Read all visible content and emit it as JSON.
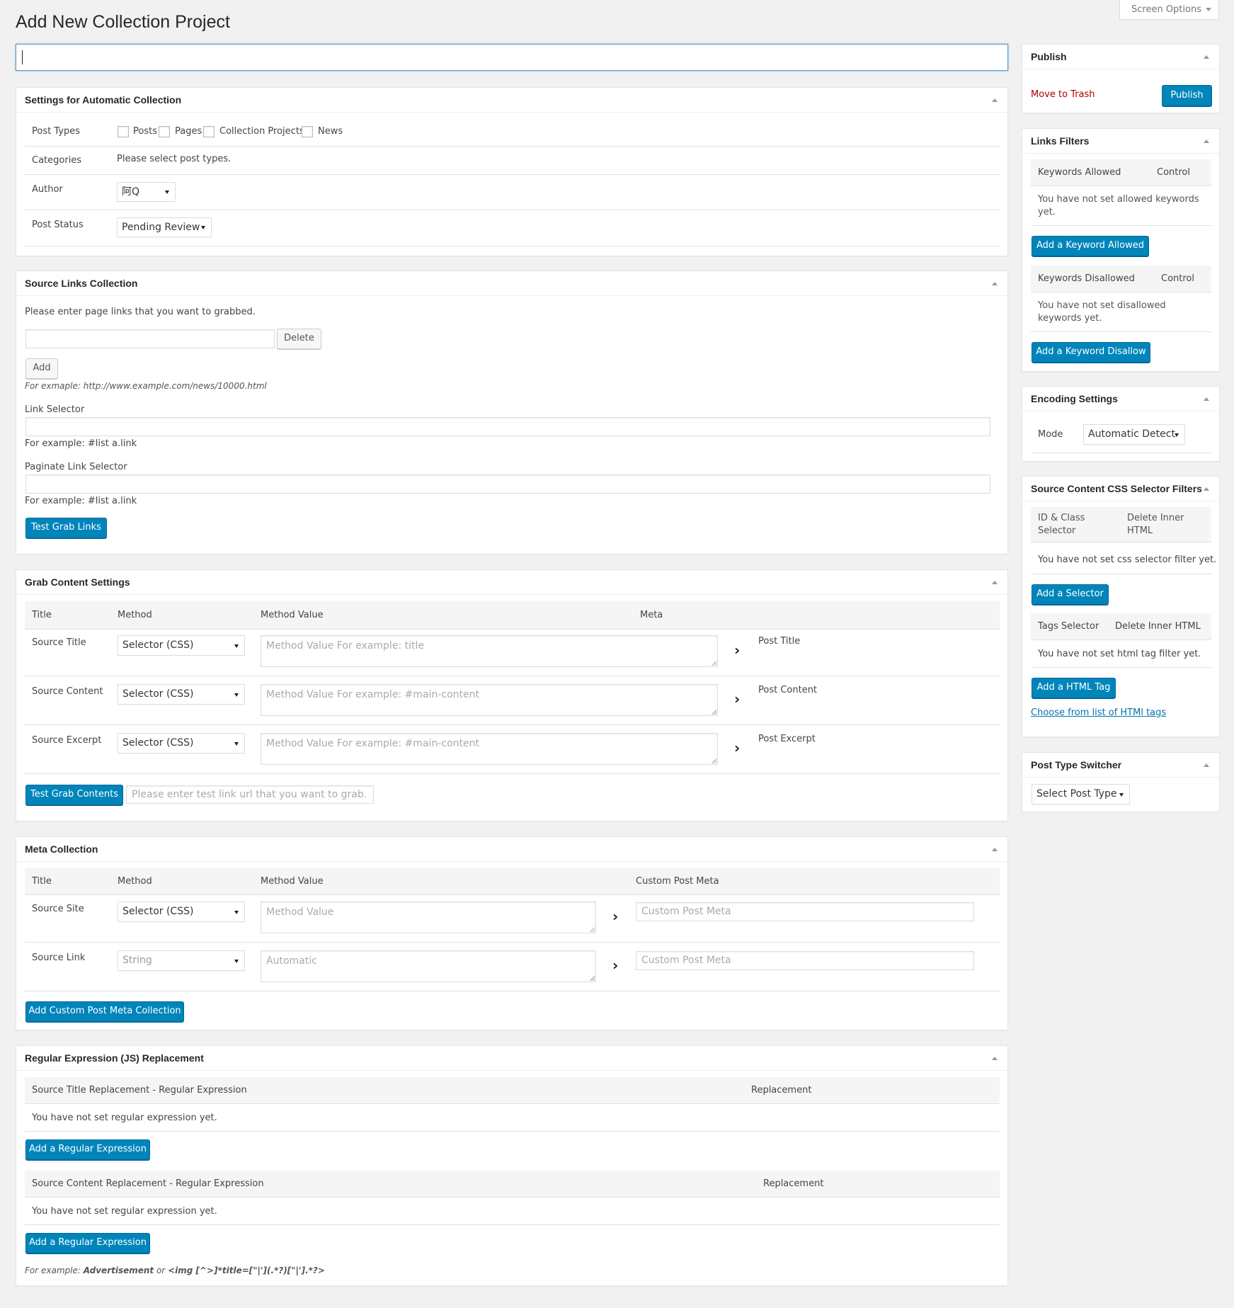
{
  "page": {
    "title": "Add New Collection Project",
    "screen_options": "Screen Options"
  },
  "automatic": {
    "heading": "Settings for Automatic Collection",
    "post_types_label": "Post Types",
    "post_types": [
      "Posts",
      "Pages",
      "Collection Projects",
      "News"
    ],
    "categories_label": "Categories",
    "categories_text": "Please select post types.",
    "author_label": "Author",
    "author_value": "阿Q",
    "status_label": "Post Status",
    "status_value": "Pending Review"
  },
  "source_links": {
    "heading": "Source Links Collection",
    "intro": "Please enter page links that you want to grabbed.",
    "delete": "Delete",
    "add": "Add",
    "example": "For exmaple: http://www.example.com/news/10000.html",
    "link_selector_label": "Link Selector",
    "link_selector_example": "For example: #list a.link",
    "paginate_label": "Paginate Link Selector",
    "paginate_example": "For example: #list a.link",
    "test_button": "Test Grab Links"
  },
  "grab": {
    "heading": "Grab Content Settings",
    "cols": [
      "Title",
      "Method",
      "Method Value",
      "Meta"
    ],
    "rows": [
      {
        "title": "Source Title",
        "method": "Selector (CSS)",
        "placeholder": "Method Value For example: title",
        "meta": "Post Title"
      },
      {
        "title": "Source Content",
        "method": "Selector (CSS)",
        "placeholder": "Method Value For example: #main-content",
        "meta": "Post Content"
      },
      {
        "title": "Source Excerpt",
        "method": "Selector (CSS)",
        "placeholder": "Method Value For example: #main-content",
        "meta": "Post Excerpt"
      }
    ],
    "test_button": "Test Grab Contents",
    "test_placeholder": "Please enter test link url that you want to grab."
  },
  "meta": {
    "heading": "Meta Collection",
    "cols": [
      "Title",
      "Method",
      "Method Value",
      "Custom Post Meta"
    ],
    "rows": [
      {
        "title": "Source Site",
        "method": "Selector (CSS)",
        "placeholder": "Method Value",
        "meta_placeholder": "Custom Post Meta"
      },
      {
        "title": "Source Link",
        "method": "String",
        "placeholder": "Automatic",
        "meta_placeholder": "Custom Post Meta"
      }
    ],
    "add_button": "Add Custom Post Meta Collection"
  },
  "regex": {
    "heading": "Regular Expression (JS) Replacement",
    "title_col": "Source Title Replacement - Regular Expression",
    "content_col": "Source Content Replacement - Regular Expression",
    "replacement": "Replacement",
    "empty": "You have not set regular expression yet.",
    "add_button": "Add a Regular Expression",
    "example_prefix": "For example: ",
    "example_a": "Advertisement",
    "example_or": " or ",
    "example_b": "<img [^>]*title=[\"|'](.*?)[\"|'].*?>"
  },
  "publish": {
    "heading": "Publish",
    "trash": "Move to Trash",
    "button": "Publish"
  },
  "links_filters": {
    "heading": "Links Filters",
    "allowed_col": "Keywords Allowed",
    "control": "Control",
    "allowed_empty": "You have not set allowed keywords yet.",
    "add_allowed": "Add a Keyword Allowed",
    "disallowed_col": "Keywords Disallowed",
    "disallowed_empty": "You have not set disallowed keywords yet.",
    "add_disallowed": "Add a Keyword Disallow"
  },
  "encoding": {
    "heading": "Encoding Settings",
    "mode_label": "Mode",
    "mode_value": "Automatic Detect"
  },
  "css_filters": {
    "heading": "Source Content CSS Selector Filters",
    "id_col": "ID & Class Selector",
    "delete_col": "Delete Inner HTML",
    "css_empty": "You have not set css selector filter yet.",
    "add_selector": "Add a Selector",
    "tags_col": "Tags Selector",
    "tags_delete_col": "Delete Inner HTML",
    "tags_empty": "You have not set html tag filter yet.",
    "add_tag": "Add a HTML Tag",
    "choose_link": "Choose from list of HTMl tags"
  },
  "switcher": {
    "heading": "Post Type Switcher",
    "value": "Select Post Type"
  },
  "colors": {
    "primary": "#0085ba",
    "trash": "#aa0000",
    "link": "#0073aa"
  }
}
